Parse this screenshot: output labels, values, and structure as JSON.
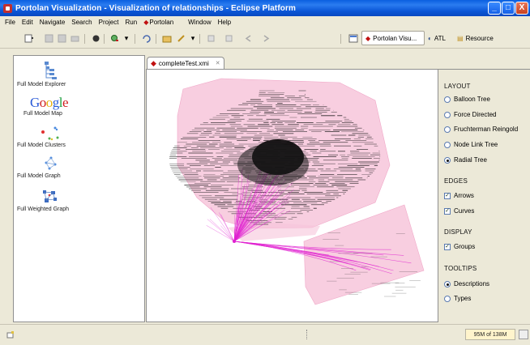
{
  "window": {
    "title": "Portolan Visualization - Visualization of relationships - Eclipse Platform",
    "buttons": {
      "minimize": "_",
      "maximize": "□",
      "close": "X"
    }
  },
  "menu": [
    "File",
    "Edit",
    "Navigate",
    "Search",
    "Project",
    "Run",
    "Portolan",
    "Window",
    "Help"
  ],
  "perspectives": {
    "portolan": "Portolan Visu...",
    "atl": "ATL",
    "resource": "Resource"
  },
  "views": [
    {
      "label": "Full Model Explorer",
      "icon": "model-explorer-icon"
    },
    {
      "label": "Full Model Map",
      "icon": "google-map-icon",
      "logo": "Google"
    },
    {
      "label": "Full Model Clusters",
      "icon": "clusters-icon"
    },
    {
      "label": "Full Model Graph",
      "icon": "graph-icon"
    },
    {
      "label": "Full Weighted Graph",
      "icon": "weighted-graph-icon"
    }
  ],
  "editor": {
    "tab": "completeTest.xmi"
  },
  "options": {
    "layout": {
      "header": "LAYOUT",
      "items": [
        {
          "label": "Balloon Tree",
          "checked": false
        },
        {
          "label": "Force Directed",
          "checked": false
        },
        {
          "label": "Fruchterman Reingold",
          "checked": false
        },
        {
          "label": "Node Link Tree",
          "checked": false
        },
        {
          "label": "Radial Tree",
          "checked": true
        }
      ]
    },
    "edges": {
      "header": "EDGES",
      "items": [
        {
          "label": "Arrows",
          "checked": true
        },
        {
          "label": "Curves",
          "checked": true
        }
      ]
    },
    "display": {
      "header": "DISPLAY",
      "items": [
        {
          "label": "Groups",
          "checked": true
        }
      ]
    },
    "tooltips": {
      "header": "TOOLTIPS",
      "items": [
        {
          "label": "Descriptions",
          "checked": true
        },
        {
          "label": "Types",
          "checked": false
        }
      ]
    }
  },
  "status": {
    "heap": "95M of 138M"
  },
  "colors": {
    "group_fill": "#f8c8dc",
    "edges": "#e020d0",
    "nodes": "#111111"
  }
}
